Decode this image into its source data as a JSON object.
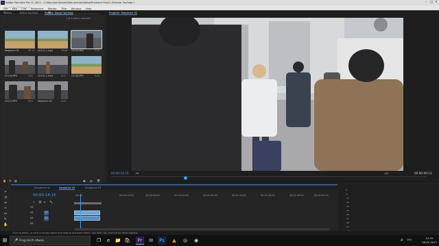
{
  "window": {
    "title": "Adobe Premiere Pro CC 2017 - C:\\Benutzer\\Daniel\\Dokumente\\Adobe\\Premiere Pro\\11.0\\Savior YouTube *"
  },
  "menu": [
    "File",
    "Edit",
    "Clip",
    "Sequence",
    "Marker",
    "Title",
    "Window",
    "Help"
  ],
  "project_panel": {
    "tabs": [
      "Effects",
      "Effect Controls",
      "Project: Savior YouTube"
    ],
    "active_tab": "Project: Savior YouTube",
    "path": "Savior YouTube.prproj",
    "search_icon": "search-icon",
    "selection_count": "1 of 8 items selected",
    "clips": [
      {
        "name": "Sequence 01",
        "duration": "49:19"
      },
      {
        "name": "C0113_1.mp4",
        "duration": "29:08"
      },
      {
        "name": "C0114.MP4",
        "duration": "3:12"
      },
      {
        "name": "C0116.MP4",
        "duration": "3:02"
      },
      {
        "name": "C0115_1.mp4",
        "duration": "4:11"
      },
      {
        "name": "C0118.MP4",
        "duration": "5:02"
      },
      {
        "name": "C0117.MP4",
        "duration": "6:03"
      },
      {
        "name": "Sequence 02",
        "duration": "2:23"
      }
    ]
  },
  "program_monitor": {
    "tab": "Program: Sequence 01",
    "timecode_current": "00:00:14:15",
    "fit": "Fit",
    "quality": "1/2",
    "timecode_duration": "00:00:09:13"
  },
  "timeline": {
    "tabs": [
      "Sequence 01",
      "Sequence 02",
      "Sequence 03"
    ],
    "active_tab": "Sequence 02",
    "timecode": "00:00:14:15",
    "ruler_ticks": [
      "00:00",
      "00:00:15:00",
      "00:00:30:00",
      "00:00:45:00",
      "00:01:00:00",
      "00:01:15:00",
      "00:01:30:00",
      "00:01:45:00",
      "00:02:00:00"
    ],
    "tracks": [
      "V2",
      "V1",
      "A1",
      "A2"
    ],
    "track_buttons": [
      "V1",
      "A1"
    ],
    "clip_label": "C0117.MP4"
  },
  "audio_meter": {
    "scale": [
      "0",
      "-6",
      "-12",
      "-18",
      "-24",
      "-30",
      "-36",
      "-42",
      "-48",
      "-54"
    ],
    "footer": "S S"
  },
  "status_bar": {
    "text": "Click to select, or click in empty space and drag to marquee select. Use Shift, Alt, and Ctrl for other options."
  },
  "taskbar": {
    "start_icon": "windows-icon",
    "search_placeholder": "Frag mich etwas",
    "apps": [
      "task-view-icon",
      "edge-icon",
      "file-explorer-icon",
      "store-icon",
      "premiere-icon",
      "mail-icon",
      "photoshop-icon",
      "vlc-icon",
      "chrome-icon",
      "firefox-icon"
    ],
    "tray_lang": "DEU",
    "time": "12:31",
    "date": "16.02.2017"
  }
}
